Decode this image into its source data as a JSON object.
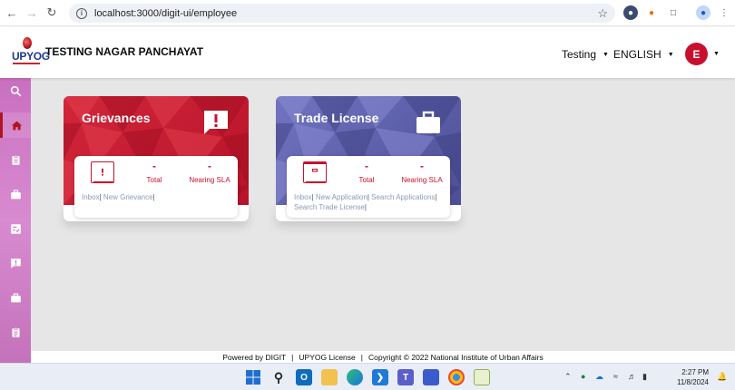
{
  "browser": {
    "url": "localhost:3000/digit-ui/employee"
  },
  "header": {
    "logo_text": "UPYOG",
    "org_name": "TESTING NAGAR PANCHAYAT",
    "city": "Testing",
    "language": "ENGLISH",
    "avatar_initial": "E"
  },
  "sidebar": {
    "items": [
      {
        "icon": "search-icon"
      },
      {
        "icon": "home-icon",
        "active": true
      },
      {
        "icon": "clipboard-icon"
      },
      {
        "icon": "briefcase-icon"
      },
      {
        "icon": "checklist-icon"
      },
      {
        "icon": "alert-icon"
      },
      {
        "icon": "briefcase-icon"
      },
      {
        "icon": "document-icon"
      }
    ]
  },
  "cards": [
    {
      "title": "Grievances",
      "color": "#c8102e",
      "icon": "alert-chat-icon",
      "total_value": "-",
      "total_label": "Total",
      "sla_value": "-",
      "sla_label": "Nearing SLA",
      "links": [
        "Inbox",
        "New Grievance"
      ]
    },
    {
      "title": "Trade License",
      "color": "#5d5fa8",
      "icon": "briefcase-icon",
      "total_value": "-",
      "total_label": "Total",
      "sla_value": "-",
      "sla_label": "Nearing SLA",
      "links": [
        "Inbox",
        "New Application",
        "Search Applications",
        "Search Trade License"
      ]
    }
  ],
  "footer": {
    "powered": "Powered by DIGIT",
    "license": "UPYOG License",
    "copyright": "Copyright © 2022 National Institute of Urban Affairs"
  },
  "taskbar": {
    "time": "2:27 PM",
    "date": "11/8/2024"
  }
}
